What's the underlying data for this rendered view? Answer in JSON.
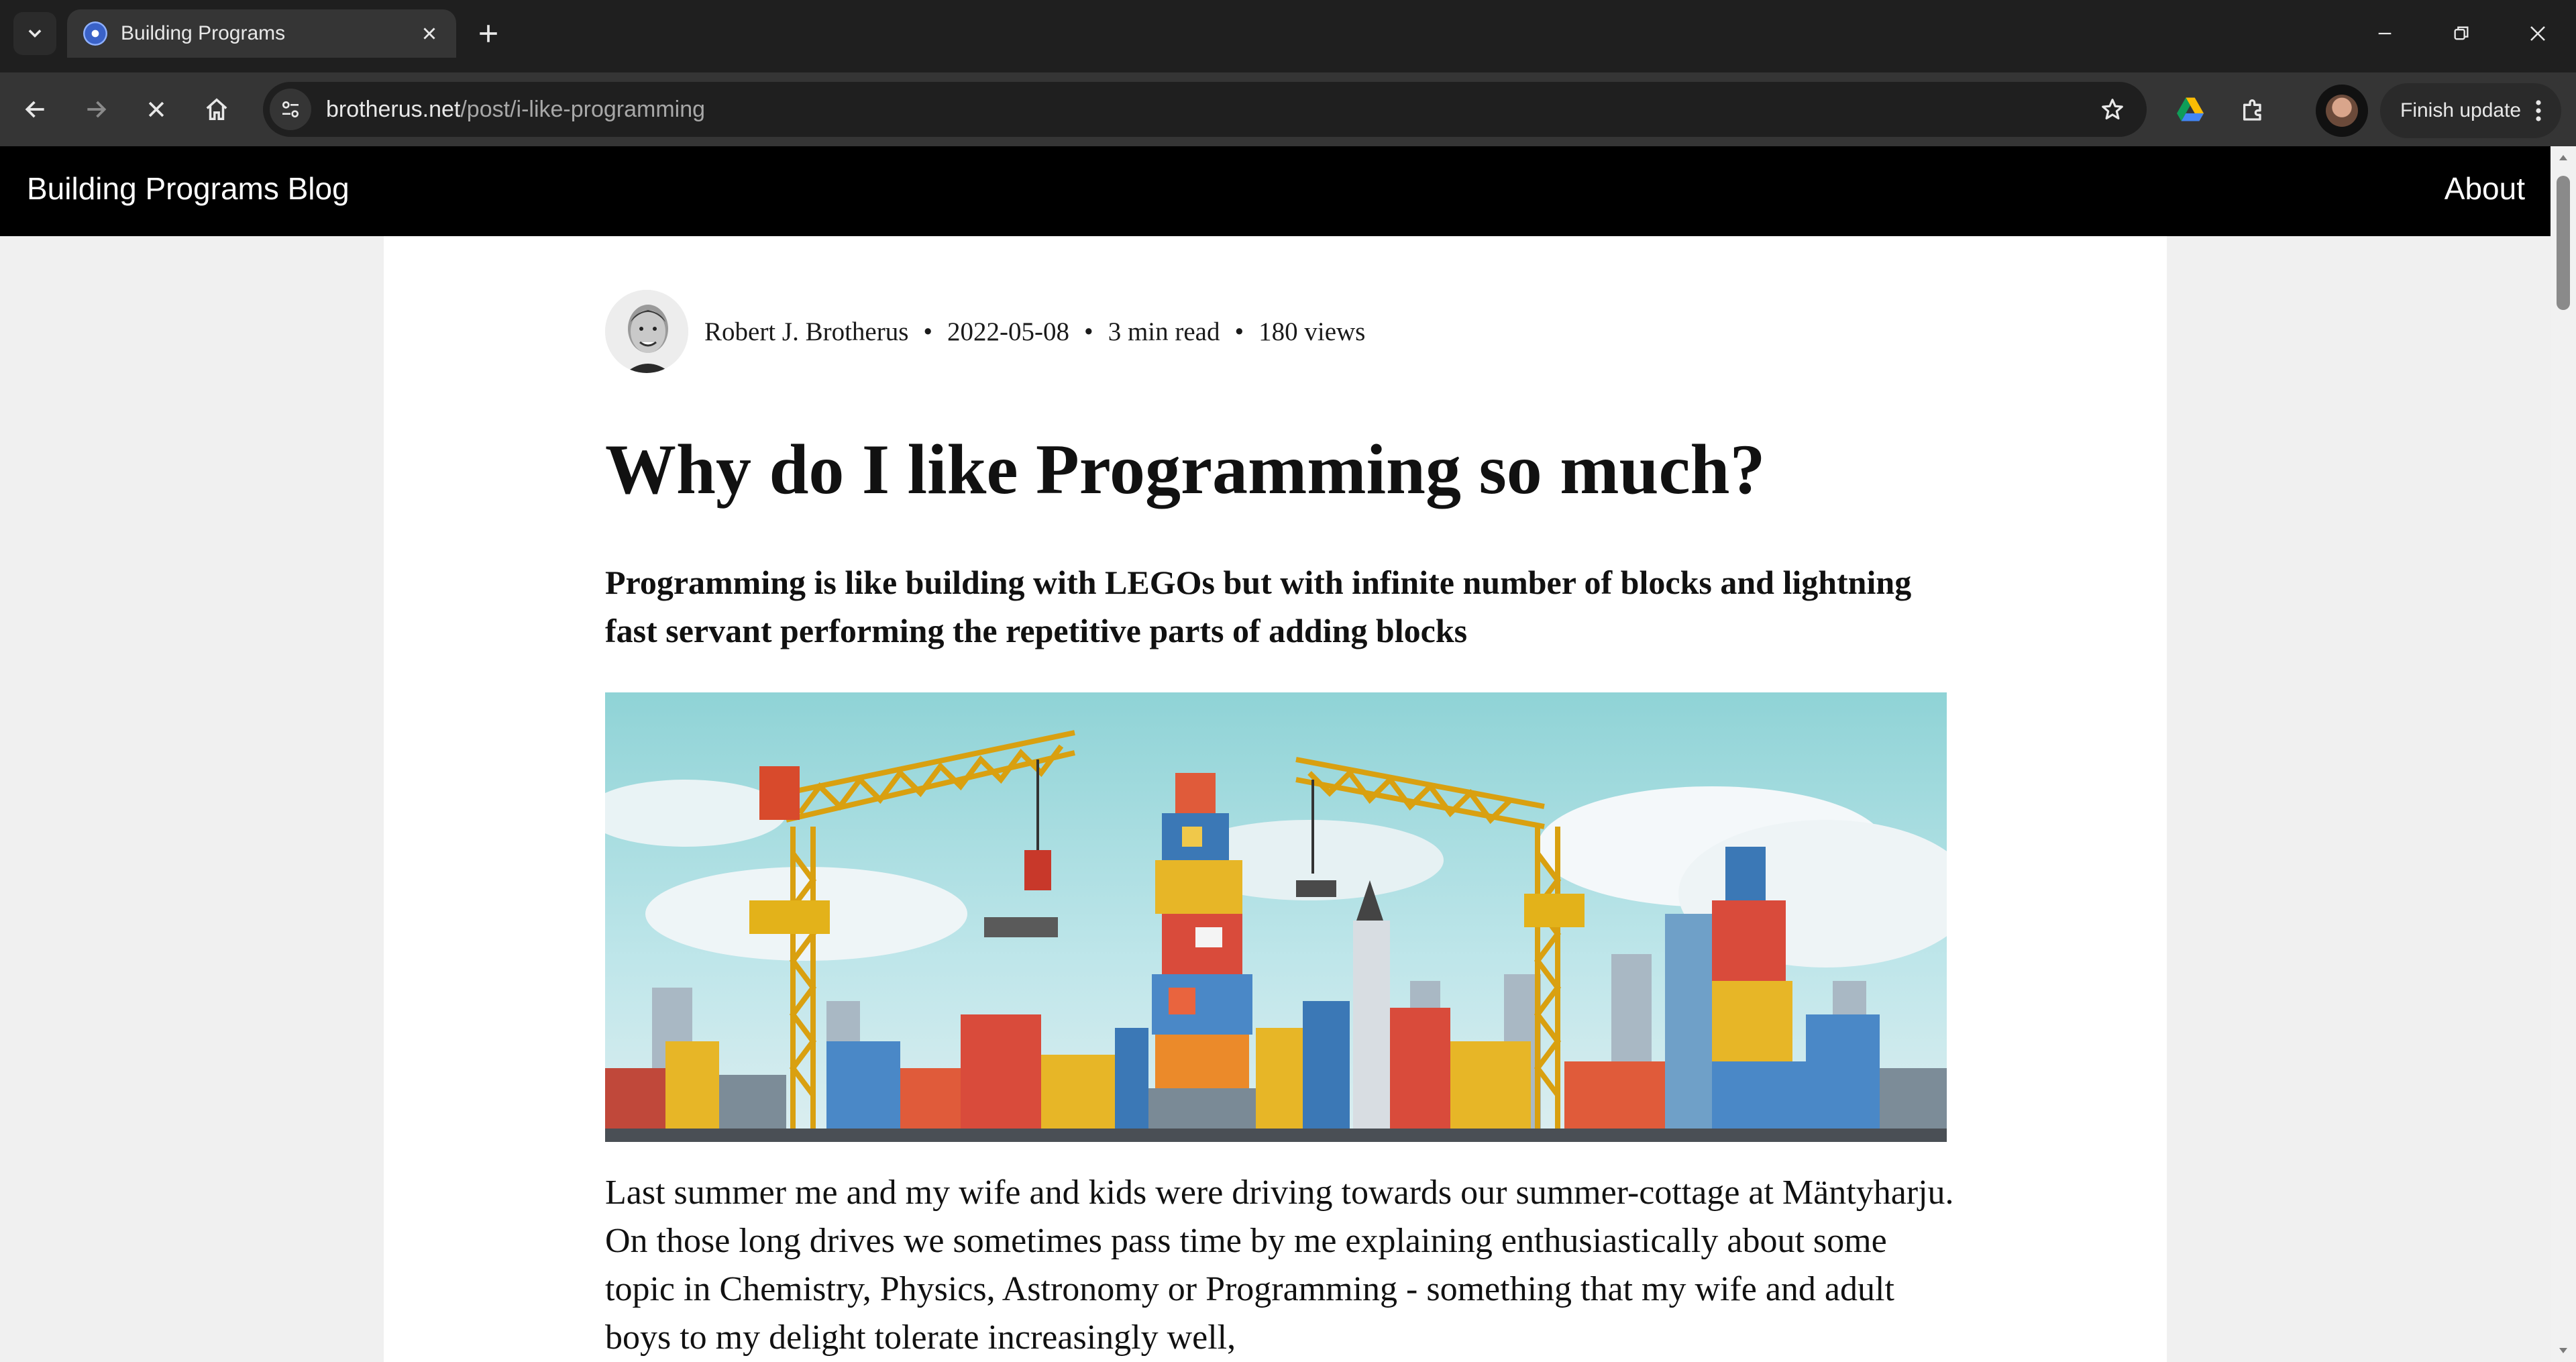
{
  "browser": {
    "tab": {
      "title": "Building Programs",
      "favicon": "site-favicon"
    },
    "url": {
      "host": "brotherus.net",
      "path": "/post/i-like-programming"
    },
    "toolbar_icons": [
      "back-icon",
      "forward-icon",
      "stop-loading-icon",
      "home-icon",
      "site-info-icon",
      "bookmark-star-icon",
      "google-drive-icon",
      "extensions-icon"
    ],
    "finish_update_label": "Finish update",
    "window_controls": [
      "minimize-icon",
      "restore-icon",
      "close-icon"
    ]
  },
  "site": {
    "title": "Building Programs Blog",
    "nav_about": "About"
  },
  "post": {
    "author": "Robert J. Brotherus",
    "date": "2022-05-08",
    "read_time": "3 min read",
    "views": "180 views",
    "separator": "•",
    "title": "Why do I like Programming so much?",
    "subtitle": "Programming is like building with LEGOs but with infinite number of blocks and lightning fast servant performing the repetitive parts of adding blocks",
    "body": "Last summer me and my wife and kids were driving towards our summer-cottage at Mäntyharju. On those long drives we sometimes pass time by me explaining enthusiastically about some topic in Chemistry, Physics, Astronomy or Programming - something that my wife and adult boys to my delight tolerate increasingly well,"
  },
  "colors": {
    "header_bg": "#000000",
    "page_bg": "#f0f0f0",
    "card_bg": "#ffffff",
    "chrome_dark": "#1f1f1f",
    "chrome_toolbar": "#353535"
  }
}
